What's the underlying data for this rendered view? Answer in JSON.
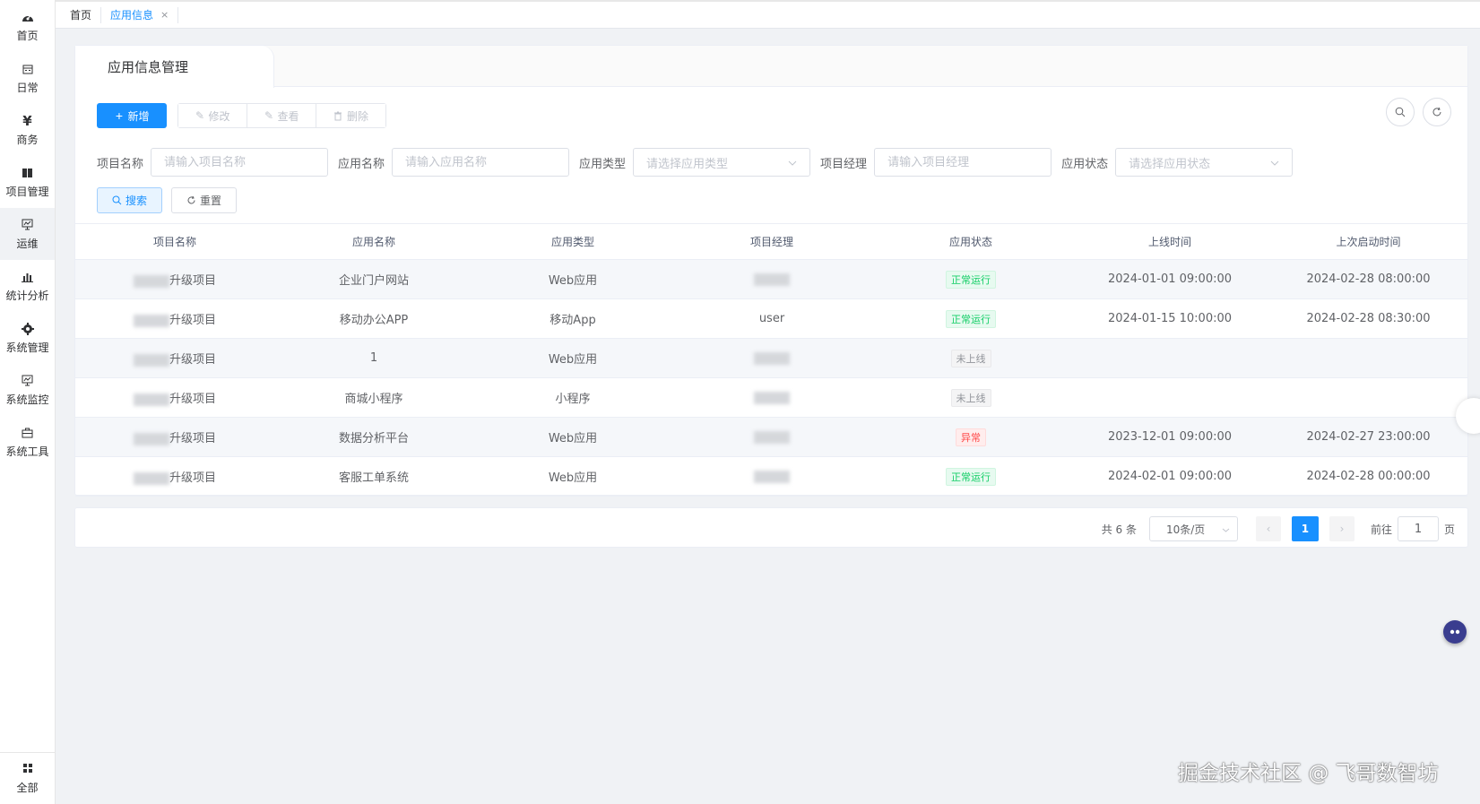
{
  "sidebar": {
    "items": [
      {
        "label": "首页",
        "icon": "dashboard-icon"
      },
      {
        "label": "日常",
        "icon": "calendar-icon"
      },
      {
        "label": "商务",
        "icon": "yen-icon"
      },
      {
        "label": "项目管理",
        "icon": "book-icon"
      },
      {
        "label": "运维",
        "icon": "monitor-icon"
      },
      {
        "label": "统计分析",
        "icon": "bar-chart-icon"
      },
      {
        "label": "系统管理",
        "icon": "gear-icon"
      },
      {
        "label": "系统监控",
        "icon": "monitor-icon"
      },
      {
        "label": "系统工具",
        "icon": "toolbox-icon"
      }
    ],
    "bottom_label": "全部"
  },
  "tabs": [
    {
      "label": "首页"
    },
    {
      "label": "应用信息",
      "close": "×"
    }
  ],
  "card": {
    "title": "应用信息管理"
  },
  "toolbar": {
    "add_label": "新增",
    "edit_label": "修改",
    "view_label": "查看",
    "delete_label": "删除"
  },
  "filters": {
    "project_name_label": "项目名称",
    "project_name_placeholder": "请输入项目名称",
    "app_name_label": "应用名称",
    "app_name_placeholder": "请输入应用名称",
    "app_type_label": "应用类型",
    "app_type_placeholder": "请选择应用类型",
    "manager_label": "项目经理",
    "manager_placeholder": "请输入项目经理",
    "status_label": "应用状态",
    "status_placeholder": "请选择应用状态",
    "search_label": "搜索",
    "reset_label": "重置"
  },
  "table": {
    "columns": [
      "项目名称",
      "应用名称",
      "应用类型",
      "项目经理",
      "应用状态",
      "上线时间",
      "上次启动时间"
    ],
    "rows": [
      {
        "project": "升级项目",
        "app": "企业门户网站",
        "type": "Web应用",
        "manager": "",
        "status": "正常运行",
        "status_kind": "ok",
        "online": "2024-01-01 09:00:00",
        "last": "2024-02-28 08:00:00"
      },
      {
        "project": "升级项目",
        "app": "移动办公APP",
        "type": "移动App",
        "manager": "user",
        "status": "正常运行",
        "status_kind": "ok",
        "online": "2024-01-15 10:00:00",
        "last": "2024-02-28 08:30:00"
      },
      {
        "project": "升级项目",
        "app": "1",
        "type": "Web应用",
        "manager": "",
        "status": "未上线",
        "status_kind": "off",
        "online": "",
        "last": ""
      },
      {
        "project": "升级项目",
        "app": "商城小程序",
        "type": "小程序",
        "manager": "",
        "status": "未上线",
        "status_kind": "off",
        "online": "",
        "last": ""
      },
      {
        "project": "升级项目",
        "app": "数据分析平台",
        "type": "Web应用",
        "manager": "",
        "status": "异常",
        "status_kind": "err",
        "online": "2023-12-01 09:00:00",
        "last": "2024-02-27 23:00:00"
      },
      {
        "project": "升级项目",
        "app": "客服工单系统",
        "type": "Web应用",
        "manager": "",
        "status": "正常运行",
        "status_kind": "ok",
        "online": "2024-02-01 09:00:00",
        "last": "2024-02-28 00:00:00"
      }
    ]
  },
  "pagination": {
    "total": "共 6 条",
    "page_size": "10条/页",
    "current": "1",
    "goto_label": "前往",
    "goto_value": "1",
    "page_suffix": "页"
  },
  "watermark": "掘金技术社区 @ 飞哥数智坊",
  "colors": {
    "primary": "#1890ff",
    "ok": "#13ce66",
    "err": "#ff4949"
  }
}
